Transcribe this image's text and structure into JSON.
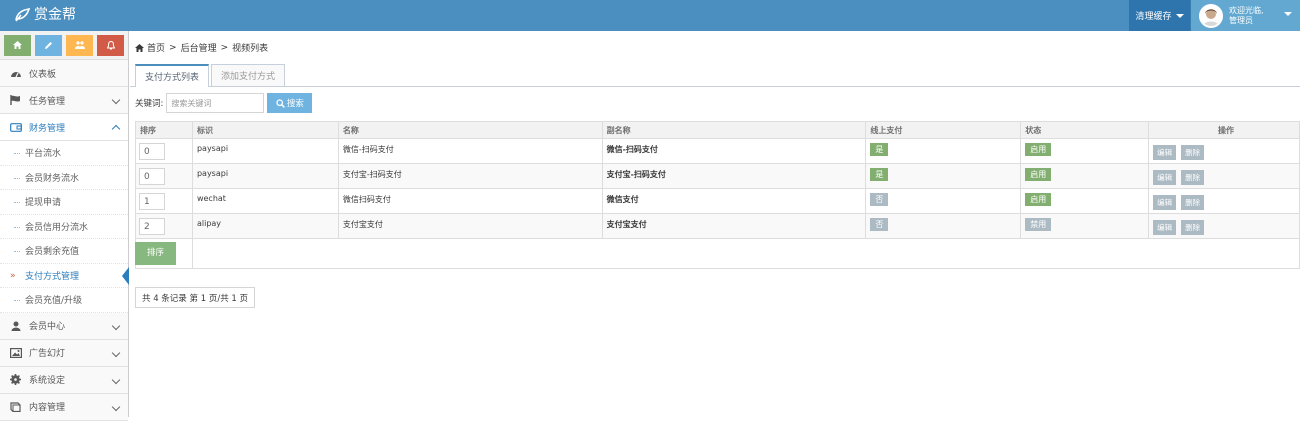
{
  "app": {
    "title": "赏金帮"
  },
  "navbar": {
    "clear_cache": "清理缓存",
    "welcome": "欢迎光临,",
    "role": "管理员"
  },
  "sidebar": {
    "items": [
      {
        "label": "仪表板",
        "icon": "dashboard-icon"
      },
      {
        "label": "任务管理",
        "icon": "flag-icon"
      },
      {
        "label": "财务管理",
        "icon": "wallet-icon"
      },
      {
        "label": "会员中心",
        "icon": "user-icon"
      },
      {
        "label": "广告幻灯",
        "icon": "picture-icon"
      },
      {
        "label": "系统设定",
        "icon": "gear-icon"
      },
      {
        "label": "内容管理",
        "icon": "book-icon"
      }
    ],
    "finance_sub": [
      "平台流水",
      "会员财务流水",
      "提现申请",
      "会员信用分流水",
      "会员剩余充值",
      "支付方式管理",
      "会员充值/升级"
    ]
  },
  "breadcrumb": {
    "home": "首页",
    "sep": ">",
    "level1": "后台管理",
    "level2": "视频列表"
  },
  "tabs": {
    "list": "支付方式列表",
    "add": "添加支付方式"
  },
  "search": {
    "label": "关键词:",
    "placeholder": "搜索关键词",
    "button": "搜索"
  },
  "table": {
    "headers": {
      "sort": "排序",
      "code": "标识",
      "name": "名称",
      "alias": "副名称",
      "online": "线上支付",
      "status": "状态",
      "ops": "操作"
    },
    "rows": [
      {
        "sort": "0",
        "code": "paysapi",
        "name": "微信-扫码支付",
        "alias": "微信-扫码支付",
        "online": "是",
        "status": "启用"
      },
      {
        "sort": "0",
        "code": "paysapi",
        "name": "支付宝-扫码支付",
        "alias": "支付宝-扫码支付",
        "online": "是",
        "status": "启用"
      },
      {
        "sort": "1",
        "code": "wechat",
        "name": "微信扫码支付",
        "alias": "微信支付",
        "online": "否",
        "status": "启用"
      },
      {
        "sort": "2",
        "code": "alipay",
        "name": "支付宝支付",
        "alias": "支付宝支付",
        "online": "否",
        "status": "禁用"
      }
    ],
    "edit_label": "编辑",
    "delete_label": "删除",
    "sort_button": "排序"
  },
  "pager": {
    "text": "共 4 条记录 第 1 页/共 1 页"
  },
  "colors": {
    "navbar": "#4a8fbf",
    "accent": "#2b7dbc",
    "green": "#82af6f",
    "gray_badge": "#abbac3"
  }
}
